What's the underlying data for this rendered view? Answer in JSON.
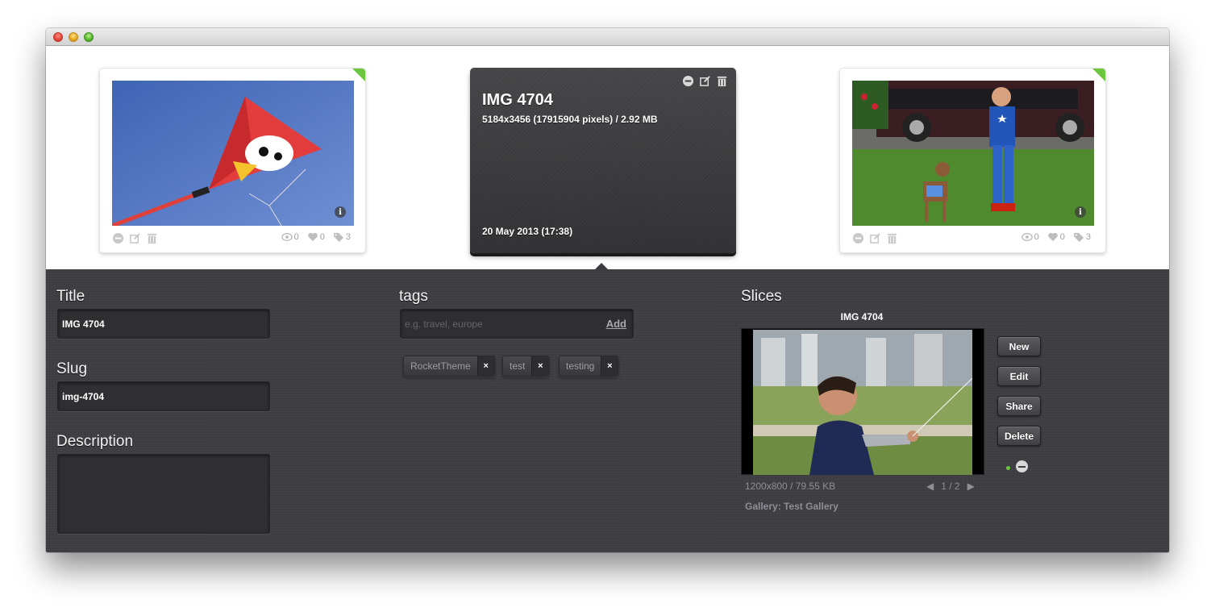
{
  "cards": [
    {
      "views": "0",
      "likes": "0",
      "tags": "3"
    },
    {
      "views": "0",
      "likes": "0",
      "tags": "3"
    }
  ],
  "selected": {
    "title": "IMG 4704",
    "dimensions": "5184x3456 (17915904 pixels) / 2.92 MB",
    "date": "20 May 2013 (17:38)"
  },
  "form": {
    "title_label": "Title",
    "title_value": "IMG 4704",
    "slug_label": "Slug",
    "slug_value": "img-4704",
    "description_label": "Description",
    "description_value": ""
  },
  "tags": {
    "label": "tags",
    "placeholder": "e.g. travel, europe",
    "add_label": "Add",
    "items": [
      "RocketTheme",
      "test",
      "testing"
    ],
    "remove_label": "×"
  },
  "slices": {
    "label": "Slices",
    "title": "IMG 4704",
    "meta": "1200x800 / 79.55 KB",
    "pager": "1 / 2",
    "prev": "◀",
    "next": "▶",
    "gallery": "Gallery: Test Gallery",
    "buttons": {
      "new": "New",
      "edit": "Edit",
      "share": "Share",
      "delete": "Delete"
    }
  },
  "colors": {
    "accent_green": "#6cc63d",
    "panel_bg": "#3f3f43"
  },
  "icons": [
    "remove-icon",
    "edit-icon",
    "trash-icon",
    "info-icon",
    "eye-icon",
    "heart-icon",
    "tag-icon"
  ]
}
